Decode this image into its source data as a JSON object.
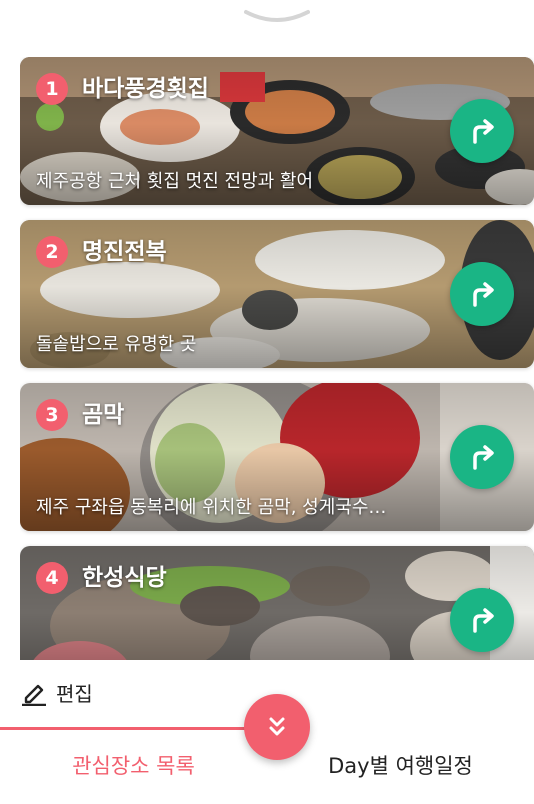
{
  "colors": {
    "accent": "#f25f6e",
    "go_button": "#1ab585",
    "badge": "#f25f6e",
    "active_tab": "#f25f6e",
    "inactive_tab": "#222222"
  },
  "handle": {
    "icon": "chevron-down-handle-icon"
  },
  "places": [
    {
      "number": "1",
      "name": "바다풍경횟집",
      "description": "제주공항 근처 횟집 멋진 전망과 활어"
    },
    {
      "number": "2",
      "name": "명진전복",
      "description": "돌솥밥으로 유명한 곳"
    },
    {
      "number": "3",
      "name": "곰막",
      "description": "제주 구좌읍 동복리에 위치한 곰막, 성게국수…"
    },
    {
      "number": "4",
      "name": "한성식당",
      "description": ""
    }
  ],
  "edit": {
    "label": "편집",
    "icon": "pencil-icon"
  },
  "tabs": {
    "left": "관심장소 목록",
    "right": "Day별 여행일정"
  },
  "collapse": {
    "icon": "double-chevron-down-icon"
  }
}
